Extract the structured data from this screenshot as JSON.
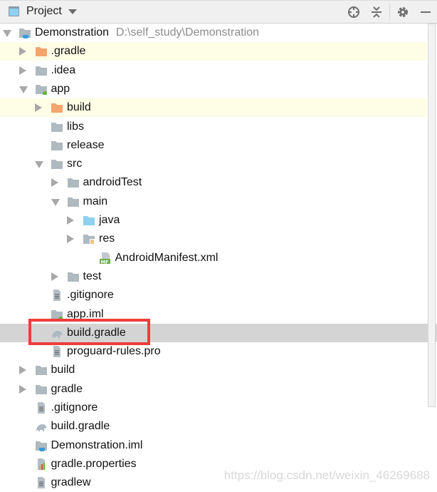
{
  "header": {
    "title": "Project",
    "icons": [
      "locate-icon",
      "collapse-all-icon",
      "gear-icon",
      "minimize-icon"
    ]
  },
  "tree": [
    {
      "level": 0,
      "arrow": "expanded",
      "icon": "module-folder",
      "label": "Demonstration",
      "path": "D:\\self_study\\Demonstration"
    },
    {
      "level": 1,
      "arrow": "collapsed",
      "icon": "folder-orange",
      "label": ".gradle",
      "highlight": true
    },
    {
      "level": 1,
      "arrow": "collapsed",
      "icon": "folder",
      "label": ".idea"
    },
    {
      "level": 1,
      "arrow": "expanded",
      "icon": "android-module-folder",
      "label": "app"
    },
    {
      "level": 2,
      "arrow": "collapsed",
      "icon": "folder-orange",
      "label": "build",
      "highlight": true
    },
    {
      "level": 2,
      "arrow": "none",
      "icon": "folder",
      "label": "libs"
    },
    {
      "level": 2,
      "arrow": "none",
      "icon": "folder",
      "label": "release"
    },
    {
      "level": 2,
      "arrow": "expanded",
      "icon": "folder",
      "label": "src"
    },
    {
      "level": 3,
      "arrow": "collapsed",
      "icon": "folder",
      "label": "androidTest"
    },
    {
      "level": 3,
      "arrow": "expanded",
      "icon": "folder",
      "label": "main"
    },
    {
      "level": 4,
      "arrow": "collapsed",
      "icon": "folder-blue",
      "label": "java"
    },
    {
      "level": 4,
      "arrow": "collapsed",
      "icon": "resource-folder",
      "label": "res"
    },
    {
      "level": 5,
      "arrow": "none",
      "icon": "manifest-file",
      "label": "AndroidManifest.xml"
    },
    {
      "level": 3,
      "arrow": "collapsed",
      "icon": "folder",
      "label": "test"
    },
    {
      "level": 2,
      "arrow": "none",
      "icon": "text-file",
      "label": ".gitignore"
    },
    {
      "level": 2,
      "arrow": "none",
      "icon": "android-module-folder",
      "label": "app.iml"
    },
    {
      "level": 2,
      "arrow": "none",
      "icon": "gradle-elephant",
      "label": "build.gradle",
      "selected": true
    },
    {
      "level": 2,
      "arrow": "none",
      "icon": "text-file",
      "label": "proguard-rules.pro"
    },
    {
      "level": 1,
      "arrow": "collapsed",
      "icon": "folder",
      "label": "build"
    },
    {
      "level": 1,
      "arrow": "collapsed",
      "icon": "folder",
      "label": "gradle"
    },
    {
      "level": 1,
      "arrow": "none",
      "icon": "text-file",
      "label": ".gitignore"
    },
    {
      "level": 1,
      "arrow": "none",
      "icon": "gradle-elephant",
      "label": "build.gradle"
    },
    {
      "level": 1,
      "arrow": "none",
      "icon": "module-folder",
      "label": "Demonstration.iml"
    },
    {
      "level": 1,
      "arrow": "none",
      "icon": "properties-file",
      "label": "gradle.properties"
    },
    {
      "level": 1,
      "arrow": "none",
      "icon": "text-file",
      "label": "gradlew"
    }
  ],
  "watermark": "https://blog.csdn.net/weixin_46269688",
  "colors": {
    "highlight": "#fefee6",
    "selected": "#d4d4d4",
    "annotation": "#f03c3c",
    "folder": "#aeb9c0",
    "folder_orange": "#f4a46c",
    "folder_blue": "#8dd1ef"
  }
}
